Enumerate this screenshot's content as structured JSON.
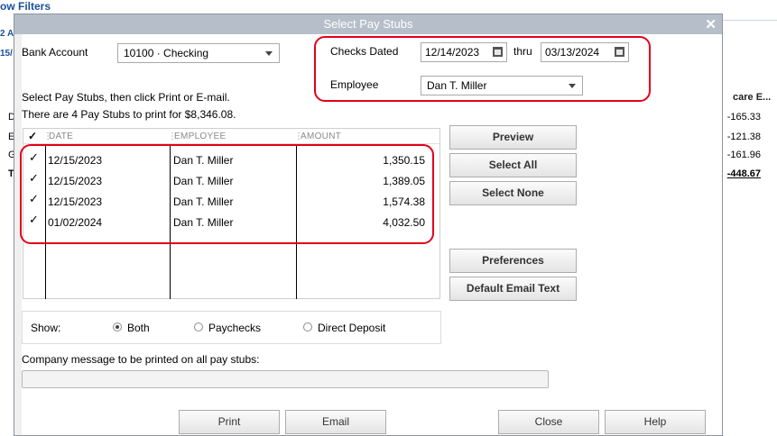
{
  "background": {
    "filters_link": "ow Filters",
    "frag1": "2 A",
    "frag2": "15/",
    "col_header": "care E...",
    "row_letters": [
      "D",
      "E",
      "G",
      "T"
    ],
    "row_values": [
      "-165.33",
      "-121.38",
      "-161.96",
      "-448.67"
    ]
  },
  "dialog": {
    "title": "Select Pay Stubs",
    "bank_account_label": "Bank Account",
    "bank_account_value": "10100 · Checking",
    "checks_dated_label": "Checks Dated",
    "date_from": "12/14/2023",
    "thru_label": "thru",
    "date_to": "03/13/2024",
    "employee_label": "Employee",
    "employee_value": "Dan T. Miller",
    "instructions_line1": "Select Pay Stubs, then click Print or E-mail.",
    "instructions_line2": "There are 4 Pay Stubs to print for $8,346.08.",
    "columns": {
      "check": "✓",
      "date": "DATE",
      "employee": "EMPLOYEE",
      "amount": "AMOUNT"
    },
    "rows": [
      {
        "checked": "✓",
        "date": "12/15/2023",
        "employee": "Dan T. Miller",
        "amount": "1,350.15"
      },
      {
        "checked": "✓",
        "date": "12/15/2023",
        "employee": "Dan T. Miller",
        "amount": "1,389.05"
      },
      {
        "checked": "✓",
        "date": "12/15/2023",
        "employee": "Dan T. Miller",
        "amount": "1,574.38"
      },
      {
        "checked": "✓",
        "date": "01/02/2024",
        "employee": "Dan T. Miller",
        "amount": "4,032.50"
      }
    ],
    "buttons": {
      "preview": "Preview",
      "select_all": "Select All",
      "select_none": "Select None",
      "preferences": "Preferences",
      "default_email_text": "Default Email Text",
      "print": "Print",
      "email": "Email",
      "close": "Close",
      "help": "Help"
    },
    "show_label": "Show:",
    "show_options": {
      "both": "Both",
      "paychecks": "Paychecks",
      "direct_deposit": "Direct Deposit"
    },
    "show_selected": "Both",
    "company_message_label": "Company message to be printed on all pay stubs:",
    "company_message_value": ""
  },
  "colors": {
    "highlight": "#e2001a",
    "titlebar": "#b6bfc9",
    "link": "#1a4f9c"
  }
}
